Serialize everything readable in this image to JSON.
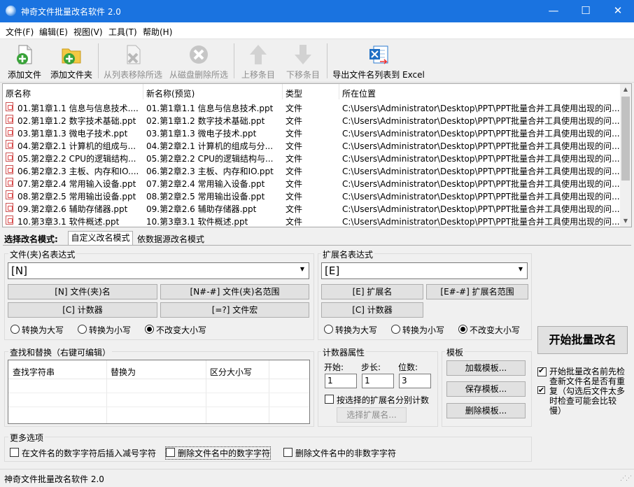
{
  "window": {
    "title": "神奇文件批量改名软件 2.0",
    "minimize": "—",
    "maximize": "☐",
    "close": "✕"
  },
  "menu": [
    "文件(F)",
    "编辑(E)",
    "视图(V)",
    "工具(T)",
    "帮助(H)"
  ],
  "toolbar": {
    "add_file": "添加文件",
    "add_folder": "添加文件夹",
    "remove_from_list": "从列表移除所选",
    "delete_from_disk": "从磁盘删除所选",
    "move_up": "上移条目",
    "move_down": "下移条目",
    "export_excel": "导出文件名列表到 Excel"
  },
  "list": {
    "columns": [
      "原名称",
      "新名称(预览)",
      "类型",
      "所在位置"
    ],
    "rows": [
      {
        "orig": "01.第1章1.1 信息与信息技术....",
        "new": "01.第1章1.1 信息与信息技术.ppt",
        "type": "文件",
        "path": "C:\\Users\\Administrator\\Desktop\\PPT\\PPT批量合并工具使用出现的问..."
      },
      {
        "orig": "02.第1章1.2 数字技术基础.ppt",
        "new": "02.第1章1.2 数字技术基础.ppt",
        "type": "文件",
        "path": "C:\\Users\\Administrator\\Desktop\\PPT\\PPT批量合并工具使用出现的问..."
      },
      {
        "orig": "03.第1章1.3 微电子技术.ppt",
        "new": "03.第1章1.3 微电子技术.ppt",
        "type": "文件",
        "path": "C:\\Users\\Administrator\\Desktop\\PPT\\PPT批量合并工具使用出现的问..."
      },
      {
        "orig": "04.第2章2.1 计算机的组成与...",
        "new": "04.第2章2.1 计算机的组成与分...",
        "type": "文件",
        "path": "C:\\Users\\Administrator\\Desktop\\PPT\\PPT批量合并工具使用出现的问..."
      },
      {
        "orig": "05.第2章2.2 CPU的逻辑结构...",
        "new": "05.第2章2.2 CPU的逻辑结构与...",
        "type": "文件",
        "path": "C:\\Users\\Administrator\\Desktop\\PPT\\PPT批量合并工具使用出现的问..."
      },
      {
        "orig": "06.第2章2.3 主板、内存和IO....",
        "new": "06.第2章2.3 主板、内存和IO.ppt",
        "type": "文件",
        "path": "C:\\Users\\Administrator\\Desktop\\PPT\\PPT批量合并工具使用出现的问..."
      },
      {
        "orig": "07.第2章2.4 常用输入设备.ppt",
        "new": "07.第2章2.4 常用输入设备.ppt",
        "type": "文件",
        "path": "C:\\Users\\Administrator\\Desktop\\PPT\\PPT批量合并工具使用出现的问..."
      },
      {
        "orig": "08.第2章2.5 常用输出设备.ppt",
        "new": "08.第2章2.5 常用输出设备.ppt",
        "type": "文件",
        "path": "C:\\Users\\Administrator\\Desktop\\PPT\\PPT批量合并工具使用出现的问..."
      },
      {
        "orig": "09.第2章2.6 辅助存储器.ppt",
        "new": "09.第2章2.6 辅助存储器.ppt",
        "type": "文件",
        "path": "C:\\Users\\Administrator\\Desktop\\PPT\\PPT批量合并工具使用出现的问..."
      },
      {
        "orig": "10.第3章3.1 软件概述.ppt",
        "new": "10.第3章3.1 软件概述.ppt",
        "type": "文件",
        "path": "C:\\Users\\Administrator\\Desktop\\PPT\\PPT批量合并工具使用出现的问..."
      }
    ]
  },
  "mode": {
    "label": "选择改名模式:",
    "tab_custom": "自定义改名模式",
    "tab_datasource": "依数据源改名模式"
  },
  "name_expr": {
    "group": "文件(夹)名表达式",
    "value": "[N]",
    "btn_name": "[N] 文件(夹)名",
    "btn_range": "[N#-#] 文件(夹)名范围",
    "btn_counter": "[C] 计数器",
    "btn_macro": "[=?] 文件宏",
    "r_upper": "转换为大写",
    "r_lower": "转换为小写",
    "r_keep": "不改变大小写"
  },
  "ext_expr": {
    "group": "扩展名表达式",
    "value": "[E]",
    "btn_ext": "[E] 扩展名",
    "btn_range": "[E#-#] 扩展名范围",
    "btn_counter": "[C] 计数器",
    "r_upper": "转换为大写",
    "r_lower": "转换为小写",
    "r_keep": "不改变大小写"
  },
  "find_replace": {
    "group": "查找和替换（右键可编辑）",
    "col_find": "查找字符串",
    "col_replace": "替换为",
    "col_case": "区分大小写"
  },
  "counter": {
    "group": "计数器属性",
    "start_label": "开始:",
    "step_label": "步长:",
    "digits_label": "位数:",
    "start": "1",
    "step": "1",
    "digits": "3",
    "per_ext": "按选择的扩展名分别计数",
    "select_ext": "选择扩展名..."
  },
  "template": {
    "group": "模板",
    "load": "加载模板...",
    "save": "保存模板...",
    "delete": "删除模板..."
  },
  "start": {
    "button": "开始批量改名",
    "check_label": "开始批量改名前先检查新文件名是否有重复（勾选后文件太多时检查可能会比较慢）"
  },
  "more": {
    "group": "更多选项",
    "opt1": "在文件名的数字字符后插入减号字符",
    "opt2": "删除文件名中的数字字符",
    "opt3": "删除文件名中的非数字字符"
  },
  "status": "神奇文件批量改名软件 2.0"
}
